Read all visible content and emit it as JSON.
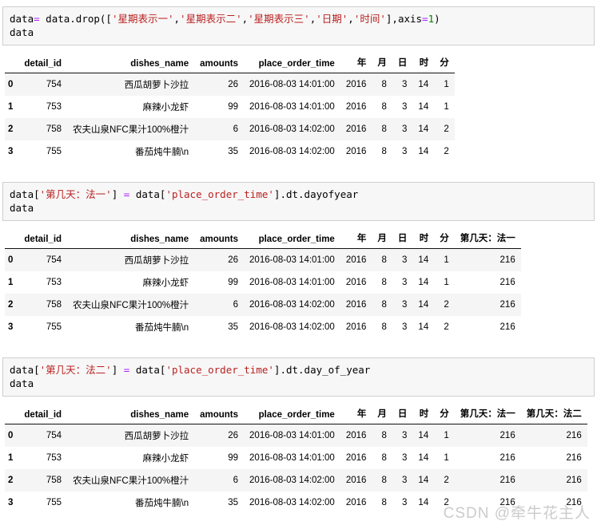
{
  "cells": [
    {
      "code_lines": [
        [
          {
            "t": "data",
            "c": "plain"
          },
          {
            "t": "=",
            "c": "op"
          },
          {
            "t": " data.drop([",
            "c": "plain"
          },
          {
            "t": "'星期表示一'",
            "c": "str"
          },
          {
            "t": ",",
            "c": "plain"
          },
          {
            "t": "'星期表示二'",
            "c": "str"
          },
          {
            "t": ",",
            "c": "plain"
          },
          {
            "t": "'星期表示三'",
            "c": "str"
          },
          {
            "t": ",",
            "c": "plain"
          },
          {
            "t": "'日期'",
            "c": "str"
          },
          {
            "t": ",",
            "c": "plain"
          },
          {
            "t": "'时间'",
            "c": "str"
          },
          {
            "t": "],axis",
            "c": "plain"
          },
          {
            "t": "=",
            "c": "op"
          },
          {
            "t": "1",
            "c": "num"
          },
          {
            "t": ")",
            "c": "plain"
          }
        ],
        [
          {
            "t": "data",
            "c": "plain"
          }
        ]
      ],
      "table": {
        "index_header": "",
        "columns": [
          "detail_id",
          "dishes_name",
          "amounts",
          "place_order_time",
          "年",
          "月",
          "日",
          "时",
          "分"
        ],
        "rows": [
          {
            "index": "0",
            "values": [
              "754",
              "西瓜胡萝卜沙拉",
              "26",
              "2016-08-03 14:01:00",
              "2016",
              "8",
              "3",
              "14",
              "1"
            ]
          },
          {
            "index": "1",
            "values": [
              "753",
              "麻辣小龙虾",
              "99",
              "2016-08-03 14:01:00",
              "2016",
              "8",
              "3",
              "14",
              "1"
            ]
          },
          {
            "index": "2",
            "values": [
              "758",
              "农夫山泉NFC果汁100%橙汁",
              "6",
              "2016-08-03 14:02:00",
              "2016",
              "8",
              "3",
              "14",
              "2"
            ]
          },
          {
            "index": "3",
            "values": [
              "755",
              "番茄炖牛腩\\n",
              "35",
              "2016-08-03 14:02:00",
              "2016",
              "8",
              "3",
              "14",
              "2"
            ]
          }
        ]
      }
    },
    {
      "code_lines": [
        [
          {
            "t": "data[",
            "c": "plain"
          },
          {
            "t": "'第几天：法一'",
            "c": "str"
          },
          {
            "t": "] ",
            "c": "plain"
          },
          {
            "t": "=",
            "c": "op"
          },
          {
            "t": " data[",
            "c": "plain"
          },
          {
            "t": "'place_order_time'",
            "c": "str"
          },
          {
            "t": "].dt.dayofyear",
            "c": "plain"
          }
        ],
        [
          {
            "t": "data",
            "c": "plain"
          }
        ]
      ],
      "table": {
        "index_header": "",
        "columns": [
          "detail_id",
          "dishes_name",
          "amounts",
          "place_order_time",
          "年",
          "月",
          "日",
          "时",
          "分",
          "第几天：法一"
        ],
        "rows": [
          {
            "index": "0",
            "values": [
              "754",
              "西瓜胡萝卜沙拉",
              "26",
              "2016-08-03 14:01:00",
              "2016",
              "8",
              "3",
              "14",
              "1",
              "216"
            ]
          },
          {
            "index": "1",
            "values": [
              "753",
              "麻辣小龙虾",
              "99",
              "2016-08-03 14:01:00",
              "2016",
              "8",
              "3",
              "14",
              "1",
              "216"
            ]
          },
          {
            "index": "2",
            "values": [
              "758",
              "农夫山泉NFC果汁100%橙汁",
              "6",
              "2016-08-03 14:02:00",
              "2016",
              "8",
              "3",
              "14",
              "2",
              "216"
            ]
          },
          {
            "index": "3",
            "values": [
              "755",
              "番茄炖牛腩\\n",
              "35",
              "2016-08-03 14:02:00",
              "2016",
              "8",
              "3",
              "14",
              "2",
              "216"
            ]
          }
        ]
      }
    },
    {
      "code_lines": [
        [
          {
            "t": "data[",
            "c": "plain"
          },
          {
            "t": "'第几天：法二'",
            "c": "str"
          },
          {
            "t": "] ",
            "c": "plain"
          },
          {
            "t": "=",
            "c": "op"
          },
          {
            "t": " data[",
            "c": "plain"
          },
          {
            "t": "'place_order_time'",
            "c": "str"
          },
          {
            "t": "].dt.day_of_year",
            "c": "plain"
          }
        ],
        [
          {
            "t": "data",
            "c": "plain"
          }
        ]
      ],
      "table": {
        "index_header": "",
        "columns": [
          "detail_id",
          "dishes_name",
          "amounts",
          "place_order_time",
          "年",
          "月",
          "日",
          "时",
          "分",
          "第几天：法一",
          "第几天：法二"
        ],
        "rows": [
          {
            "index": "0",
            "values": [
              "754",
              "西瓜胡萝卜沙拉",
              "26",
              "2016-08-03 14:01:00",
              "2016",
              "8",
              "3",
              "14",
              "1",
              "216",
              "216"
            ]
          },
          {
            "index": "1",
            "values": [
              "753",
              "麻辣小龙虾",
              "99",
              "2016-08-03 14:01:00",
              "2016",
              "8",
              "3",
              "14",
              "1",
              "216",
              "216"
            ]
          },
          {
            "index": "2",
            "values": [
              "758",
              "农夫山泉NFC果汁100%橙汁",
              "6",
              "2016-08-03 14:02:00",
              "2016",
              "8",
              "3",
              "14",
              "2",
              "216",
              "216"
            ]
          },
          {
            "index": "3",
            "values": [
              "755",
              "番茄炖牛腩\\n",
              "35",
              "2016-08-03 14:02:00",
              "2016",
              "8",
              "3",
              "14",
              "2",
              "216",
              "216"
            ]
          }
        ]
      }
    }
  ],
  "watermark": {
    "text": "CSDN @牵牛花主人"
  },
  "colors": {
    "code_bg": "#f7f7f7",
    "code_border": "#cfcfcf",
    "string": "#ba2121",
    "operator": "#aa22ff",
    "number": "#008000",
    "row_stripe": "#f5f5f5",
    "header_rule": "#111111",
    "watermark": "#c9c9c9"
  }
}
